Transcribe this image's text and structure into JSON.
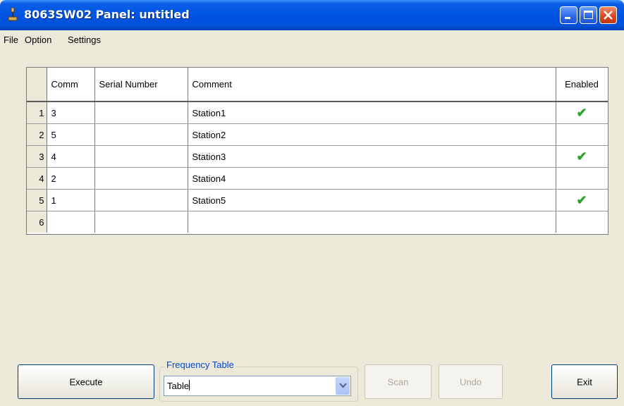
{
  "window": {
    "title": "8063SW02 Panel: untitled",
    "controls": [
      "minimize-icon",
      "maximize-icon",
      "close-icon"
    ]
  },
  "menu": {
    "items": [
      "File",
      "Option",
      "Settings"
    ]
  },
  "grid": {
    "columns": [
      "",
      "Comm",
      "Serial Number",
      "Comment",
      "Enabled"
    ],
    "rows": [
      {
        "num": "1",
        "comm": "3",
        "serial": "",
        "comment": "Station1",
        "enabled": true
      },
      {
        "num": "2",
        "comm": "5",
        "serial": "",
        "comment": "Station2",
        "enabled": false
      },
      {
        "num": "3",
        "comm": "4",
        "serial": "",
        "comment": "Station3",
        "enabled": true
      },
      {
        "num": "4",
        "comm": "2",
        "serial": "",
        "comment": "Station4",
        "enabled": false
      },
      {
        "num": "5",
        "comm": "1",
        "serial": "",
        "comment": "Station5",
        "enabled": true
      },
      {
        "num": "6",
        "comm": "",
        "serial": "",
        "comment": "",
        "enabled": false
      }
    ],
    "check_symbol": "✔",
    "check_color": "#2ea32a"
  },
  "buttons": {
    "execute": "Execute",
    "scan": "Scan",
    "undo": "Undo",
    "exit": "Exit"
  },
  "frequency_table": {
    "label": "Frequency Table",
    "value": "Table"
  },
  "colors": {
    "titlebar": "#0054e3",
    "window_bg": "#ece9d8",
    "group_label": "#0046d5"
  }
}
